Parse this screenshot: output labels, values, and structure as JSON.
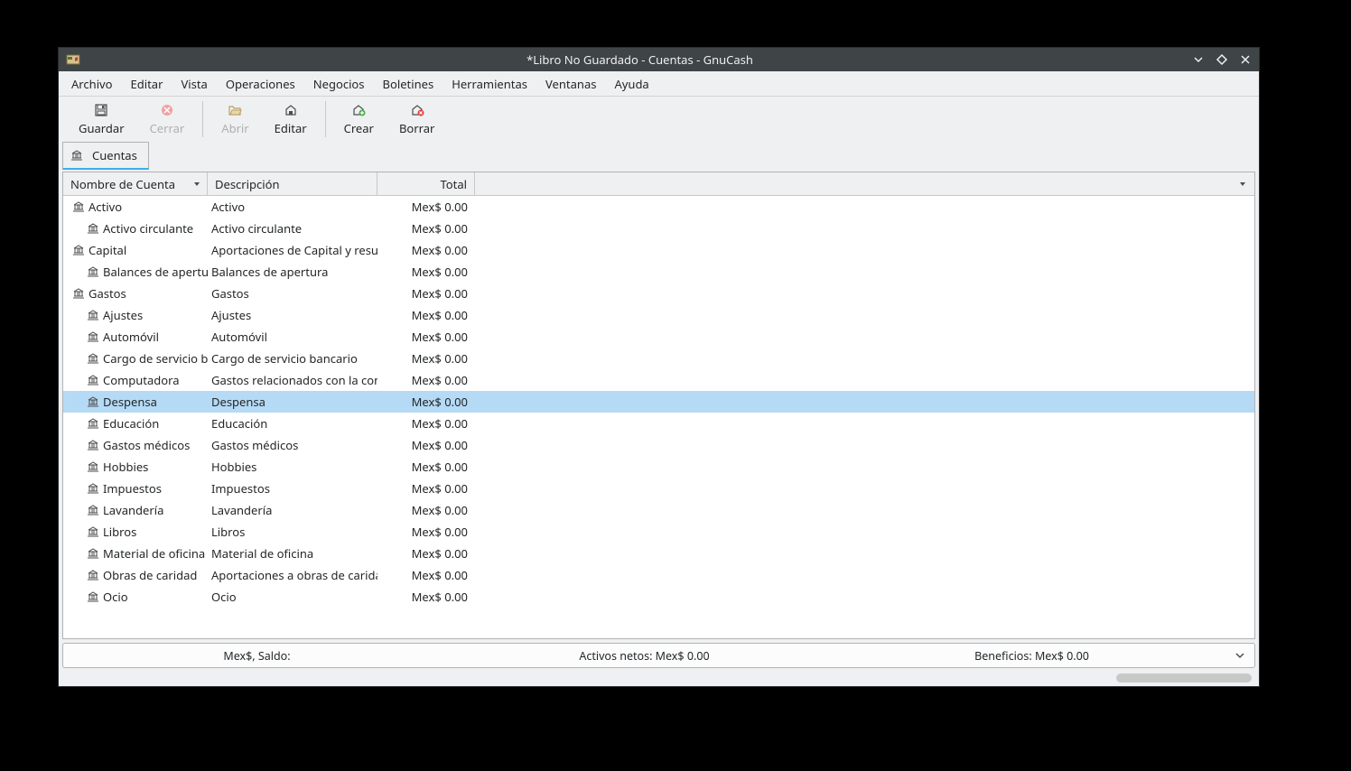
{
  "window": {
    "title": "*Libro No Guardado - Cuentas - GnuCash"
  },
  "menubar": [
    "Archivo",
    "Editar",
    "Vista",
    "Operaciones",
    "Negocios",
    "Boletines",
    "Herramientas",
    "Ventanas",
    "Ayuda"
  ],
  "toolbar": [
    {
      "label": "Guardar",
      "icon": "save",
      "disabled": false
    },
    {
      "label": "Cerrar",
      "icon": "close-red",
      "disabled": true
    },
    {
      "sep": true
    },
    {
      "label": "Abrir",
      "icon": "open",
      "disabled": true
    },
    {
      "label": "Editar",
      "icon": "edit-house",
      "disabled": false
    },
    {
      "sep": true
    },
    {
      "label": "Crear",
      "icon": "create-house",
      "disabled": false
    },
    {
      "label": "Borrar",
      "icon": "delete-house",
      "disabled": false
    }
  ],
  "tab": {
    "label": "Cuentas"
  },
  "columns": {
    "name": "Nombre de Cuenta",
    "desc": "Descripción",
    "total": "Total"
  },
  "rows": [
    {
      "indent": 0,
      "name": "Activo",
      "desc": "Activo",
      "total": "Mex$ 0.00"
    },
    {
      "indent": 1,
      "name": "Activo circulante",
      "desc": "Activo circulante",
      "total": "Mex$ 0.00"
    },
    {
      "indent": 0,
      "name": "Capital",
      "desc": "Aportaciones de Capital y resul",
      "total": "Mex$ 0.00"
    },
    {
      "indent": 1,
      "name": "Balances de apertur",
      "desc": "Balances de apertura",
      "total": "Mex$ 0.00"
    },
    {
      "indent": 0,
      "name": "Gastos",
      "desc": "Gastos",
      "total": "Mex$ 0.00"
    },
    {
      "indent": 1,
      "name": "Ajustes",
      "desc": "Ajustes",
      "total": "Mex$ 0.00"
    },
    {
      "indent": 1,
      "name": "Automóvil",
      "desc": "Automóvil",
      "total": "Mex$ 0.00"
    },
    {
      "indent": 1,
      "name": "Cargo de servicio ba",
      "desc": "Cargo de servicio bancario",
      "total": "Mex$ 0.00"
    },
    {
      "indent": 1,
      "name": "Computadora",
      "desc": "Gastos relacionados con la com",
      "total": "Mex$ 0.00"
    },
    {
      "indent": 1,
      "name": "Despensa",
      "desc": "Despensa",
      "total": "Mex$ 0.00",
      "selected": true
    },
    {
      "indent": 1,
      "name": "Educación",
      "desc": "Educación",
      "total": "Mex$ 0.00"
    },
    {
      "indent": 1,
      "name": "Gastos médicos",
      "desc": "Gastos médicos",
      "total": "Mex$ 0.00"
    },
    {
      "indent": 1,
      "name": "Hobbies",
      "desc": "Hobbies",
      "total": "Mex$ 0.00"
    },
    {
      "indent": 1,
      "name": "Impuestos",
      "desc": "Impuestos",
      "total": "Mex$ 0.00"
    },
    {
      "indent": 1,
      "name": "Lavandería",
      "desc": "Lavandería",
      "total": "Mex$ 0.00"
    },
    {
      "indent": 1,
      "name": "Libros",
      "desc": "Libros",
      "total": "Mex$ 0.00"
    },
    {
      "indent": 1,
      "name": "Material de oficina",
      "desc": "Material de oficina",
      "total": "Mex$ 0.00"
    },
    {
      "indent": 1,
      "name": "Obras de caridad",
      "desc": "Aportaciones a obras de carida",
      "total": "Mex$ 0.00"
    },
    {
      "indent": 1,
      "name": "Ocio",
      "desc": "Ocio",
      "total": "Mex$ 0.00"
    }
  ],
  "statusbar": {
    "saldo": "Mex$, Saldo:",
    "activos": "Activos netos: Mex$ 0.00",
    "beneficios": "Beneficios: Mex$ 0.00"
  }
}
